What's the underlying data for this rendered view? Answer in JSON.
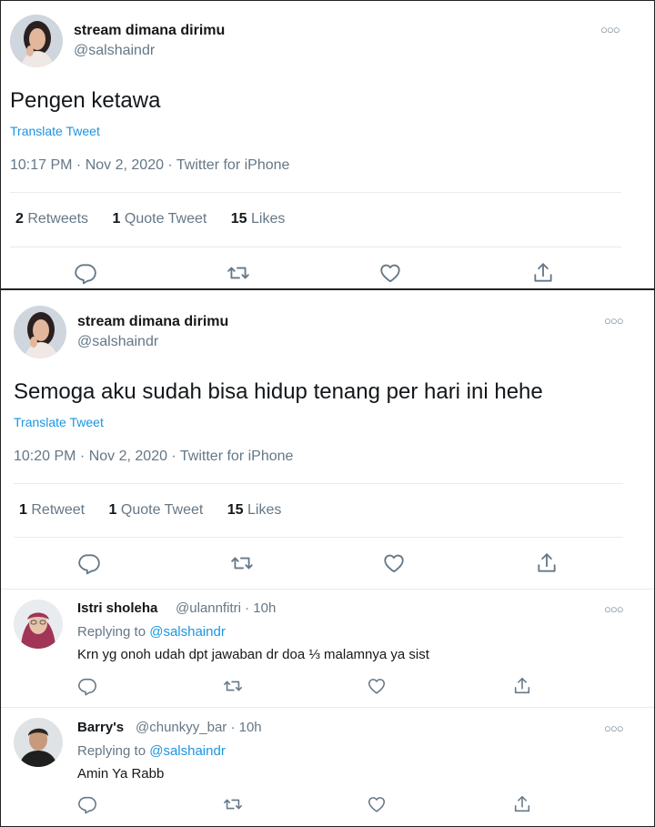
{
  "tweet1": {
    "display_name": "stream dimana dirimu",
    "handle": "@salshaindr",
    "text": "Pengen ketawa",
    "translate": "Translate Tweet",
    "timestamp": "10:17 PM · Nov 2, 2020 · Twitter for iPhone",
    "retweets_count": "2",
    "retweets_label": "Retweets",
    "quotes_count": "1",
    "quotes_label": "Quote Tweet",
    "likes_count": "15",
    "likes_label": "Likes"
  },
  "tweet2": {
    "display_name": "stream dimana dirimu",
    "handle": "@salshaindr",
    "text": "Semoga aku sudah bisa hidup tenang  per hari ini hehe",
    "translate": "Translate Tweet",
    "timestamp": "10:20 PM · Nov 2, 2020 · Twitter for iPhone",
    "retweets_count": "1",
    "retweets_label": "Retweet",
    "quotes_count": "1",
    "quotes_label": "Quote Tweet",
    "likes_count": "15",
    "likes_label": "Likes"
  },
  "replies": [
    {
      "display_name": "Istri sholeha",
      "handle_time": "@ulannfitri · 10h",
      "replying_prefix": "Replying to",
      "replying_to": "@salshaindr",
      "text": "Krn yg onoh udah dpt jawaban dr doa ⅓ malamnya ya sist"
    },
    {
      "display_name": "Barry's",
      "handle_time": "@chunkyy_bar · 10h",
      "replying_prefix": "Replying to",
      "replying_to": "@salshaindr",
      "text": "Amin Ya Rabb"
    }
  ],
  "icons": {
    "more": "more-horizontal-icon",
    "reply": "reply-icon",
    "retweet": "retweet-icon",
    "like": "heart-icon",
    "share": "share-icon"
  },
  "colors": {
    "link": "#1b95e0",
    "secondary_text": "#657786",
    "primary_text": "#14171a",
    "divider": "#e6ecf0"
  }
}
